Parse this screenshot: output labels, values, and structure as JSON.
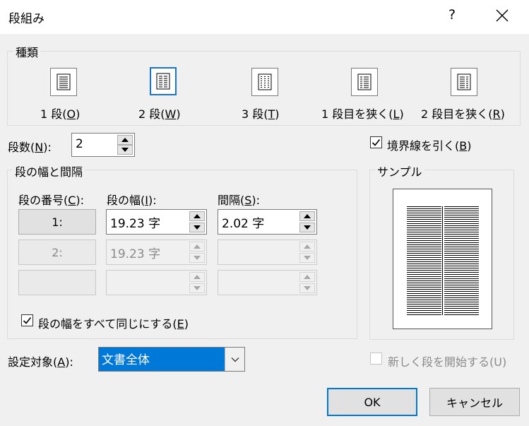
{
  "dialog": {
    "title": "段組み",
    "help": "?"
  },
  "type_group": {
    "label": "種類",
    "options": [
      {
        "pre": "1 段(",
        "key": "O",
        "post": ")",
        "selected": false
      },
      {
        "pre": "2 段(",
        "key": "W",
        "post": ")",
        "selected": true
      },
      {
        "pre": "3 段(",
        "key": "T",
        "post": ")",
        "selected": false
      },
      {
        "pre": "1 段目を狭く(",
        "key": "L",
        "post": ")",
        "selected": false
      },
      {
        "pre": "2 段目を狭く(",
        "key": "R",
        "post": ")",
        "selected": false
      }
    ]
  },
  "columns": {
    "pre": "段数(",
    "key": "N",
    "post": "):",
    "value": "2"
  },
  "line_between": {
    "pre": "境界線を引く(",
    "key": "B",
    "post": ")",
    "checked": true
  },
  "width_group": {
    "label": "段の幅と間隔",
    "col_header": {
      "pre": "段の番号(",
      "key": "C",
      "post": "):"
    },
    "width_header": {
      "pre": "段の幅(",
      "key": "I",
      "post": "):"
    },
    "spacing_header": {
      "pre": "間隔(",
      "key": "S",
      "post": "):"
    },
    "rows": [
      {
        "num": "1:",
        "width": "19.23 字",
        "spacing": "2.02 字",
        "enabled": true
      },
      {
        "num": "2:",
        "width": "19.23 字",
        "spacing": "",
        "enabled": false
      },
      {
        "num": "",
        "width": "",
        "spacing": "",
        "enabled": false
      }
    ],
    "equal": {
      "pre": "段の幅をすべて同じにする(",
      "key": "E",
      "post": ")",
      "checked": true
    }
  },
  "sample": {
    "label": "サンプル"
  },
  "apply_to": {
    "pre": "設定対象(",
    "key": "A",
    "post": "):",
    "value": "文書全体"
  },
  "new_column": {
    "label": "新しく段を開始する(U)",
    "checked": false,
    "enabled": false
  },
  "buttons": {
    "ok": "OK",
    "cancel": "キャンセル"
  },
  "colors": {
    "accent": "#0078d7",
    "selected_border": "#1874d2"
  }
}
